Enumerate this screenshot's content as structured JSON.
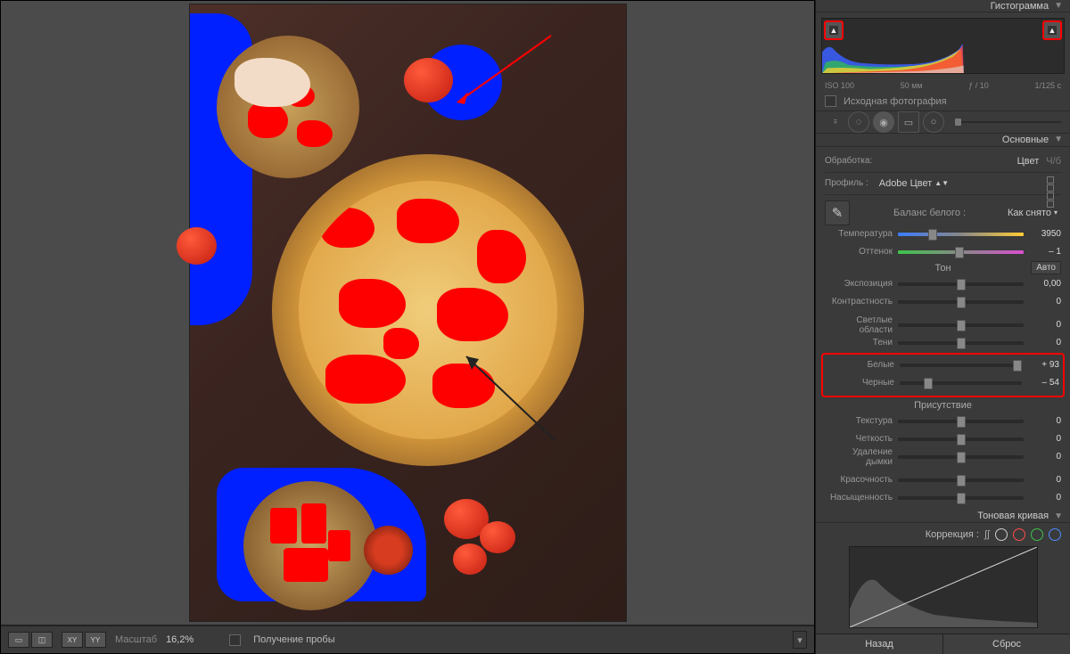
{
  "panels": {
    "histogram": {
      "title": "Гистограмма",
      "iso": "ISO 100",
      "focal": "50 мм",
      "aperture": "ƒ / 10",
      "shutter": "1/125 с",
      "source_photo": "Исходная фотография"
    },
    "basic": {
      "title": "Основные",
      "treatment_label": "Обработка:",
      "treatment_color": "Цвет",
      "treatment_bw": "Ч/б",
      "profile_label": "Профиль :",
      "profile_value": "Adobe Цвет",
      "wb_label": "Баланс белого :",
      "wb_value": "Как снято",
      "temp_label": "Температура",
      "temp_value": "3950",
      "tint_label": "Оттенок",
      "tint_value": "– 1",
      "tone_title": "Тон",
      "auto": "Авто",
      "exposure_label": "Экспозиция",
      "exposure_value": "0,00",
      "contrast_label": "Контрастность",
      "contrast_value": "0",
      "highlights_label": "Светлые области",
      "highlights_value": "0",
      "shadows_label": "Тени",
      "shadows_value": "0",
      "whites_label": "Белые",
      "whites_value": "+ 93",
      "blacks_label": "Черные",
      "blacks_value": "– 54",
      "presence_title": "Присутствие",
      "texture_label": "Текстура",
      "texture_value": "0",
      "clarity_label": "Четкость",
      "clarity_value": "0",
      "dehaze_label": "Удаление дымки",
      "dehaze_value": "0",
      "vibrance_label": "Красочность",
      "vibrance_value": "0",
      "saturation_label": "Насыщенность",
      "saturation_value": "0"
    },
    "curve": {
      "title": "Тоновая кривая",
      "correction": "Коррекция :"
    }
  },
  "bottom": {
    "zoom_label": "Масштаб",
    "zoom_value": "16,2%",
    "sample": "Получение пробы",
    "back": "Назад",
    "reset": "Сброс"
  }
}
